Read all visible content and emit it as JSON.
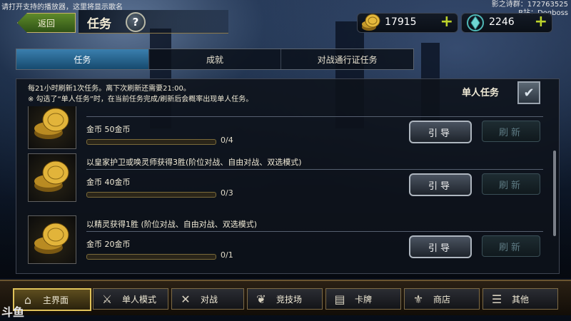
{
  "overlay": {
    "player_notice": "请打开支持的播放器，这里将显示歌名",
    "streamer_line1": "影之诗群：172763525",
    "streamer_line2": "B站：Dogboss"
  },
  "header": {
    "back_label": "返回",
    "title": "任务",
    "help_label": "?"
  },
  "currency": {
    "gold": "17915",
    "crystal": "2246",
    "add_label": "+"
  },
  "tabs": [
    {
      "label": "任务",
      "active": true
    },
    {
      "label": "成就",
      "active": false
    },
    {
      "label": "对战通行证任务",
      "active": false
    }
  ],
  "panel": {
    "refresh_info": "每21小时刷新1次任务。离下次刷新还需要21:00。",
    "solo_note": "※ 勾选了“单人任务”时，在当前任务完成/刷新后会概率出现单人任务。",
    "solo_label": "单人任务",
    "solo_checked": true
  },
  "quests": [
    {
      "description": "",
      "reward": "金币 50金币",
      "progress": "0/4",
      "progress_fraction": 0,
      "guide_label": "引导",
      "refresh_label": "刷新"
    },
    {
      "description": "以皇家护卫或唤灵师获得3胜(阶位对战、自由对战、双选模式)",
      "reward": "金币 40金币",
      "progress": "0/3",
      "progress_fraction": 0,
      "guide_label": "引导",
      "refresh_label": "刷新"
    },
    {
      "description": "以精灵获得1胜 (阶位对战、自由对战、双选模式)",
      "reward": "金币 20金币",
      "progress": "0/1",
      "progress_fraction": 0,
      "guide_label": "引导",
      "refresh_label": "刷新"
    }
  ],
  "bottom_nav": [
    {
      "label": "主界面",
      "icon": "home-icon",
      "active": true
    },
    {
      "label": "单人模式",
      "icon": "sword-icon",
      "active": false
    },
    {
      "label": "对战",
      "icon": "crossed-swords-icon",
      "active": false
    },
    {
      "label": "竞技场",
      "icon": "laurel-icon",
      "active": false
    },
    {
      "label": "卡牌",
      "icon": "cards-icon",
      "active": false
    },
    {
      "label": "商店",
      "icon": "shop-icon",
      "active": false
    },
    {
      "label": "其他",
      "icon": "more-icon",
      "active": false
    }
  ],
  "corner_logo": "斗鱼",
  "colors": {
    "accent_gold": "#e0c25a",
    "tab_active": "#3a7fae",
    "plus_green": "#bdd32b"
  }
}
